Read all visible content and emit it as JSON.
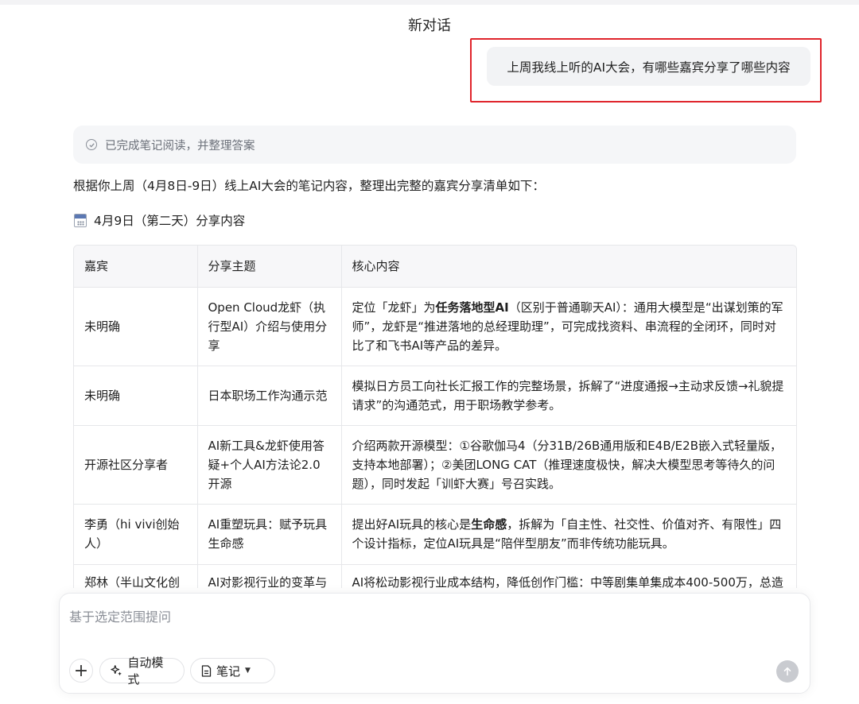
{
  "window": {
    "title": "新对话"
  },
  "user_message": {
    "text": "上周我线上听的AI大会，有哪些嘉宾分享了哪些内容"
  },
  "status": {
    "text": "已完成笔记阅读，并整理答案"
  },
  "answer": {
    "intro": "根据你上周（4月8日-9日）线上AI大会的笔记内容，整理出完整的嘉宾分享清单如下：",
    "day_heading": "4月9日（第二天）分享内容",
    "table": {
      "headers": [
        "嘉宾",
        "分享主题",
        "核心内容"
      ],
      "rows": [
        {
          "guest": "未明确",
          "topic": "Open Cloud龙虾（执行型AI）介绍与使用分享",
          "content_pre": "定位「龙虾」为",
          "content_bold": "任务落地型AI",
          "content_post": "（区别于普通聊天AI）：通用大模型是“出谋划策的军师”，龙虾是“推进落地的总经理助理”，可完成找资料、串流程的全闭环，同时对比了和飞书AI等产品的差异。"
        },
        {
          "guest": "未明确",
          "topic": "日本职场工作沟通示范",
          "content_pre": "模拟日方员工向社长汇报工作的完整场景，拆解了“进度通报→主动求反馈→礼貌提请求”的沟通范式，用于职场教学参考。",
          "content_bold": "",
          "content_post": ""
        },
        {
          "guest": "开源社区分享者",
          "topic": "AI新工具&龙虾使用答疑+个人AI方法论2.0开源",
          "content_pre": "介绍两款开源模型：①谷歌伽马4（分31B/26B通用版和E4B/E2B嵌入式轻量版，支持本地部署）；②美团LONG CAT（推理速度极快，解决大模型思考等待久的问题），同时发起「训虾大赛」号召实践。",
          "content_bold": "",
          "content_post": ""
        },
        {
          "guest": "李勇（hi vivi创始人）",
          "topic": "AI重塑玩具：赋予玩具生命感",
          "content_pre": "提出好AI玩具的核心是",
          "content_bold": "生命感",
          "content_post": "，拆解为「自主性、社交性、价值对齐、有限性」四个设计指标，定位AI玩具是“陪伴型朋友”而非传统功能玩具。"
        },
        {
          "guest": "郑林（半山文化创",
          "topic": "AI对影视行业的变革与",
          "content_pre": "AI将松动影视行业成本结构，降低创作门槛：中等剧集单集成本400-500万，总造",
          "content_bold": "",
          "content_post": ""
        }
      ]
    }
  },
  "composer": {
    "placeholder": "基于选定范围提问",
    "mode_label": "自动模式",
    "source_label": "笔记"
  }
}
